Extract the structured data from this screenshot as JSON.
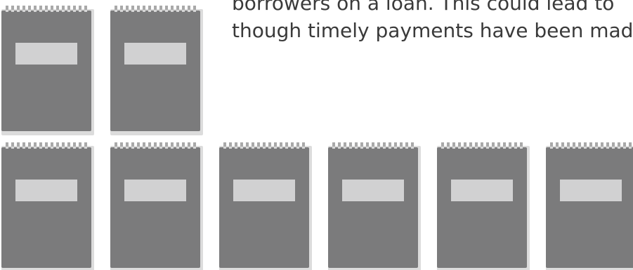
{
  "caption": {
    "line1": "borrowers on a loan. This could lead to",
    "line2": "though timely payments have been mad"
  },
  "colors": {
    "notebook_cover": "#7b7b7c",
    "notebook_label": "#d1d1d2",
    "notebook_shadow": "#dcdcdc",
    "spiral": "#a9a9a9",
    "text": "#3a3a3a"
  },
  "icons": {
    "notebook": "notebook-icon",
    "spiral": "spiral-binding-icon"
  }
}
